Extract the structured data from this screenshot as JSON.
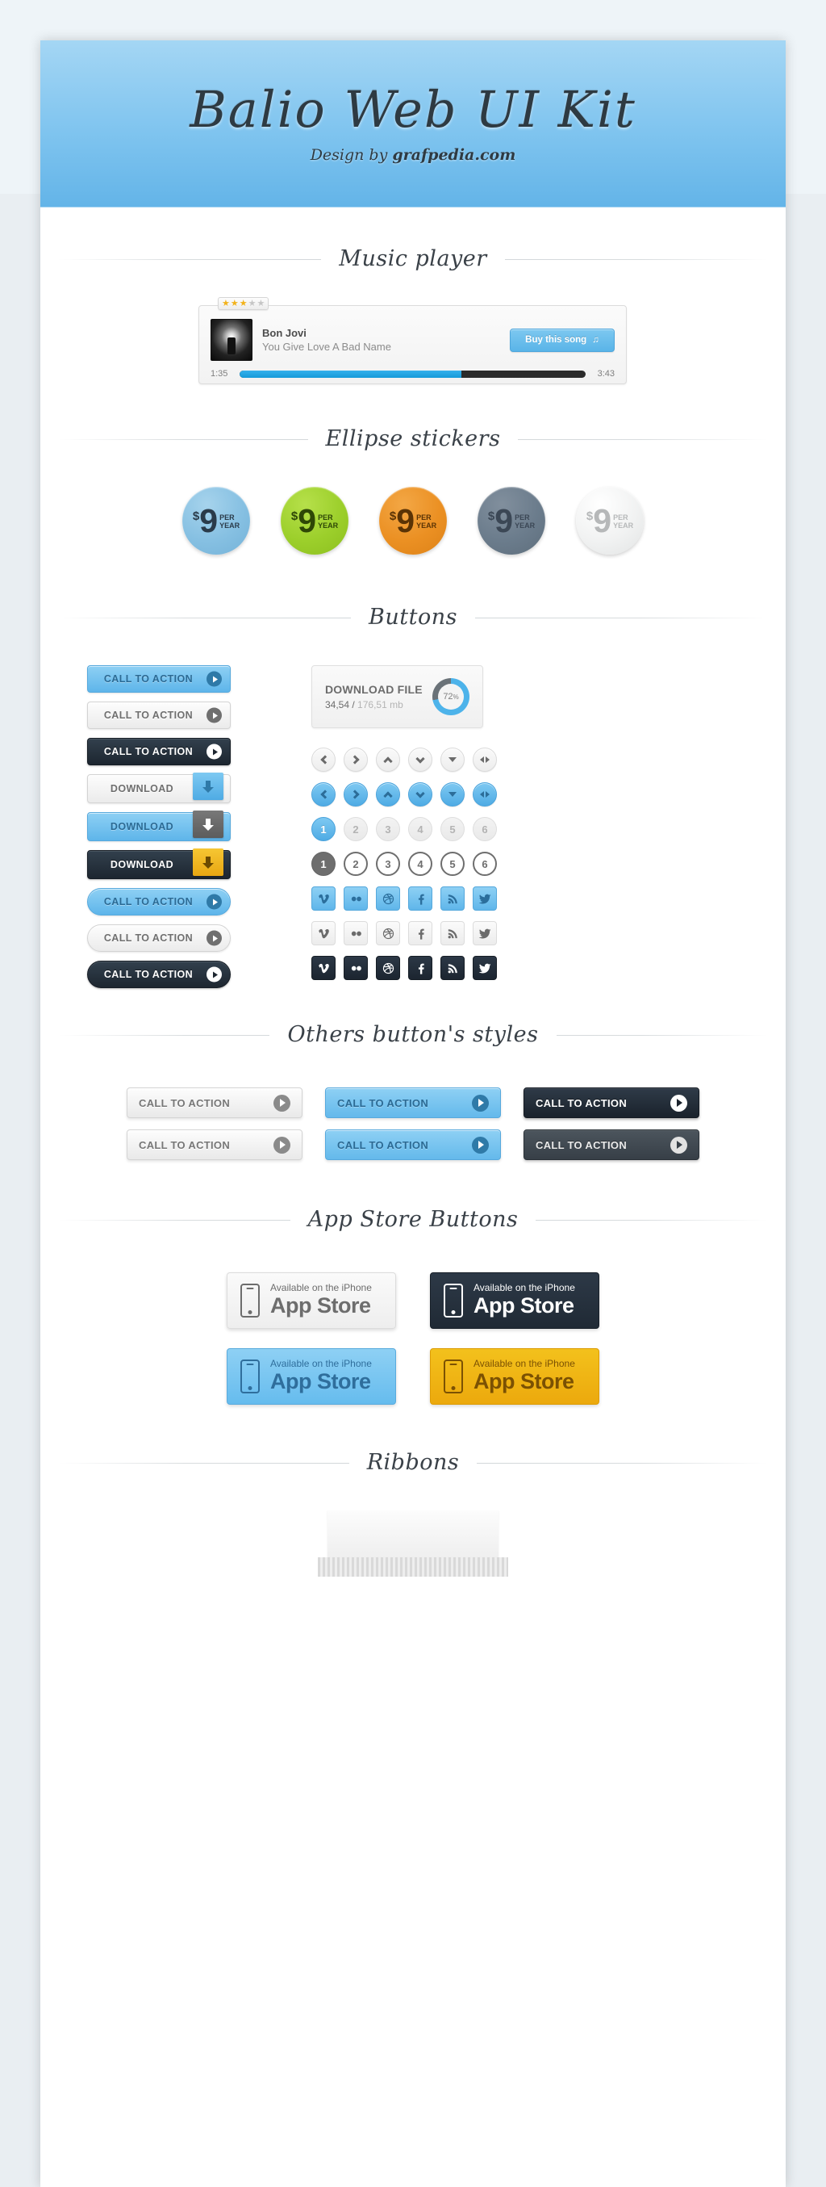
{
  "banner": {
    "title": "Balio Web UI Kit",
    "subtitle_prefix": "Design by ",
    "subtitle_brand": "grafpedia.com"
  },
  "sections": {
    "music_player": "Music player",
    "ellipse_stickers": "Ellipse stickers",
    "buttons": "Buttons",
    "others_button_styles": "Others button's styles",
    "app_store_buttons": "App Store Buttons",
    "ribbons": "Ribbons"
  },
  "music_player": {
    "rating_filled": 3,
    "rating_total": 5,
    "star_glyph": "★",
    "artist": "Bon Jovi",
    "song": "You Give Love A Bad Name",
    "buy_label": "Buy this song",
    "note_glyph": "♫",
    "time_current": "1:35",
    "time_total": "3:43",
    "progress_percent": 64
  },
  "stickers": [
    {
      "dollar": "$",
      "amount": "9",
      "per": "PER",
      "unit": "YEAR",
      "color": "#86c0e2",
      "text": "#2a3b4a"
    },
    {
      "dollar": "$",
      "amount": "9",
      "per": "PER",
      "unit": "YEAR",
      "color": "#9ccf2b",
      "text": "#2e4706"
    },
    {
      "dollar": "$",
      "amount": "9",
      "per": "PER",
      "unit": "YEAR",
      "color": "#eb9023",
      "text": "#5a3305"
    },
    {
      "dollar": "$",
      "amount": "9",
      "per": "PER",
      "unit": "YEAR",
      "color": "#6b7c8c",
      "text": "#3b4755"
    },
    {
      "dollar": "$",
      "amount": "9",
      "per": "PER",
      "unit": "YEAR",
      "color": "#eceded",
      "text": "#b6b8b9"
    }
  ],
  "buttons_column": [
    {
      "type": "cta",
      "label": "CALL TO ACTION",
      "style": "blue"
    },
    {
      "type": "cta",
      "label": "CALL TO ACTION",
      "style": "grey"
    },
    {
      "type": "cta",
      "label": "CALL TO ACTION",
      "style": "dark"
    },
    {
      "type": "download",
      "label": "DOWNLOAD",
      "style": "light"
    },
    {
      "type": "download",
      "label": "DOWNLOAD",
      "style": "blue"
    },
    {
      "type": "download",
      "label": "DOWNLOAD",
      "style": "dark"
    },
    {
      "type": "cta-round",
      "label": "CALL TO ACTION",
      "style": "blue"
    },
    {
      "type": "cta-round",
      "label": "CALL TO ACTION",
      "style": "grey"
    },
    {
      "type": "cta-round",
      "label": "CALL TO ACTION",
      "style": "dark"
    }
  ],
  "download_file": {
    "title": "DOWNLOAD FILE",
    "done": "34,54",
    "separator": " / ",
    "total": "176,51 mb",
    "percent": "72",
    "percent_suffix": "%"
  },
  "arrow_buttons": {
    "icons": [
      "chevron-left-icon",
      "chevron-right-icon",
      "chevron-up-icon",
      "chevron-down-icon",
      "triangle-down-icon",
      "left-right-arrows-icon"
    ],
    "row_grey_style": "grey",
    "row_blue_style": "blue"
  },
  "pagination": {
    "pages": [
      "1",
      "2",
      "3",
      "4",
      "5",
      "6"
    ],
    "active": "1"
  },
  "social": {
    "names": [
      "vimeo-icon",
      "flickr-icon",
      "dribbble-icon",
      "facebook-icon",
      "rss-icon",
      "twitter-icon"
    ],
    "rows": [
      "blue",
      "grey",
      "dark"
    ]
  },
  "others_buttons": {
    "rows": [
      [
        {
          "label": "CALL TO ACTION",
          "style": "lg"
        },
        {
          "label": "CALL TO ACTION",
          "style": "bl"
        },
        {
          "label": "CALL TO ACTION",
          "style": "bk"
        }
      ],
      [
        {
          "label": "CALL TO ACTION",
          "style": "lg"
        },
        {
          "label": "CALL TO ACTION",
          "style": "bl"
        },
        {
          "label": "CALL TO ACTION",
          "style": "dg"
        }
      ]
    ]
  },
  "app_store": {
    "tagline": "Available on the iPhone",
    "store": "App Store",
    "variants": [
      "light",
      "dark",
      "blue",
      "gold"
    ]
  },
  "colors": {
    "accent_blue": "#5eb5ea",
    "dark": "#1d2630",
    "gold": "#eca90d",
    "banner_blue": "#7fc4ef"
  }
}
